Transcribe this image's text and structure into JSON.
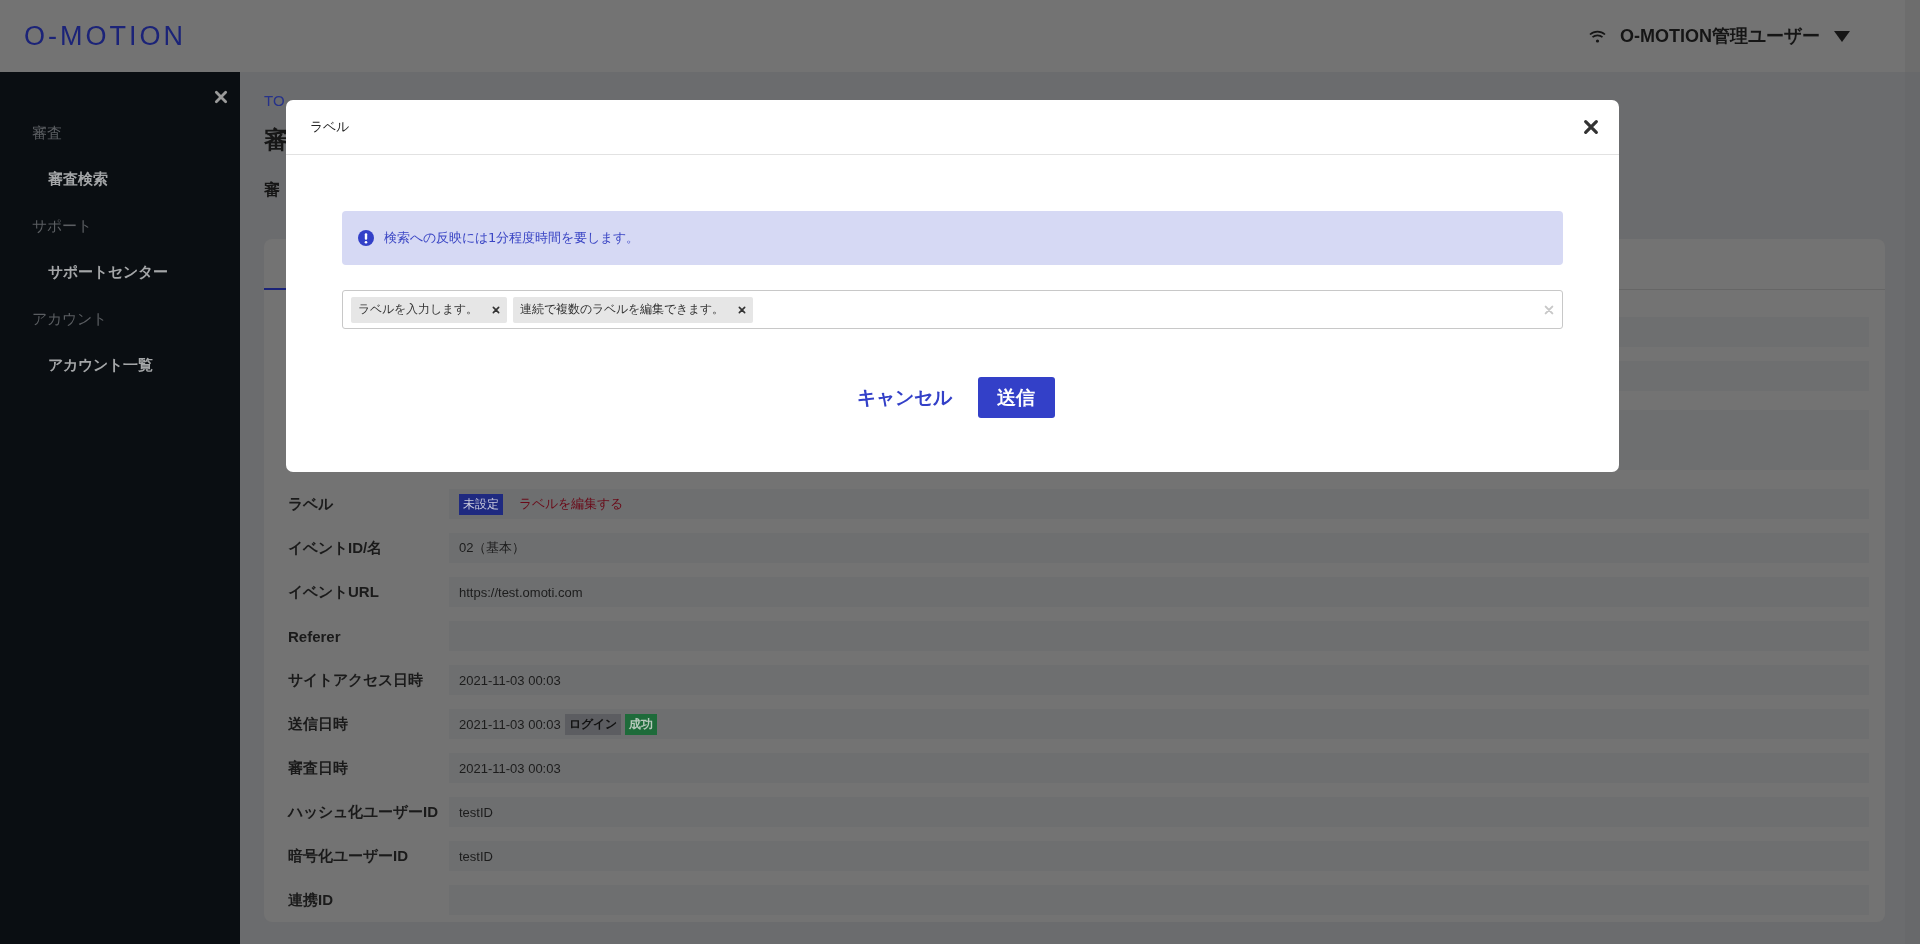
{
  "header": {
    "logo": "O-MOTION",
    "user": "O-MOTION管理ユーザー"
  },
  "sidebar": {
    "sections": [
      {
        "heading": "審査",
        "items": [
          {
            "label": "審査検索"
          }
        ]
      },
      {
        "heading": "サポート",
        "items": [
          {
            "label": "サポートセンター"
          }
        ]
      },
      {
        "heading": "アカウント",
        "items": [
          {
            "label": "アカウント一覧"
          }
        ]
      }
    ]
  },
  "breadcrumb": "TO",
  "page_title": "審",
  "section_title": "審",
  "details": [
    {
      "label": "ラベル",
      "badges": [
        {
          "text": "未設定",
          "kind": "status"
        }
      ],
      "link": "ラベルを編集する"
    },
    {
      "label": "イベントID/名",
      "value": "02（基本）"
    },
    {
      "label": "イベントURL",
      "value": "https://test.omoti.com"
    },
    {
      "label": "Referer"
    },
    {
      "label": "サイトアクセス日時",
      "value": "2021-11-03 00:03"
    },
    {
      "label": "送信日時",
      "value": "2021-11-03 00:03",
      "badges": [
        {
          "text": "ログイン",
          "kind": "type"
        },
        {
          "text": "成功",
          "kind": "result"
        }
      ]
    },
    {
      "label": "審査日時",
      "value": "2021-11-03 00:03"
    },
    {
      "label": "ハッシュ化ユーザーID",
      "value": "testID"
    },
    {
      "label": "暗号化ユーザーID",
      "value": "testID"
    },
    {
      "label": "連携ID"
    }
  ],
  "modal": {
    "title": "ラベル",
    "alert": "検索への反映には1分程度時間を要します。",
    "tags": [
      {
        "text": "ラベルを入力します。"
      },
      {
        "text": "連続で複数のラベルを編集できます。"
      }
    ],
    "cancel": "キャンセル",
    "submit": "送信"
  }
}
